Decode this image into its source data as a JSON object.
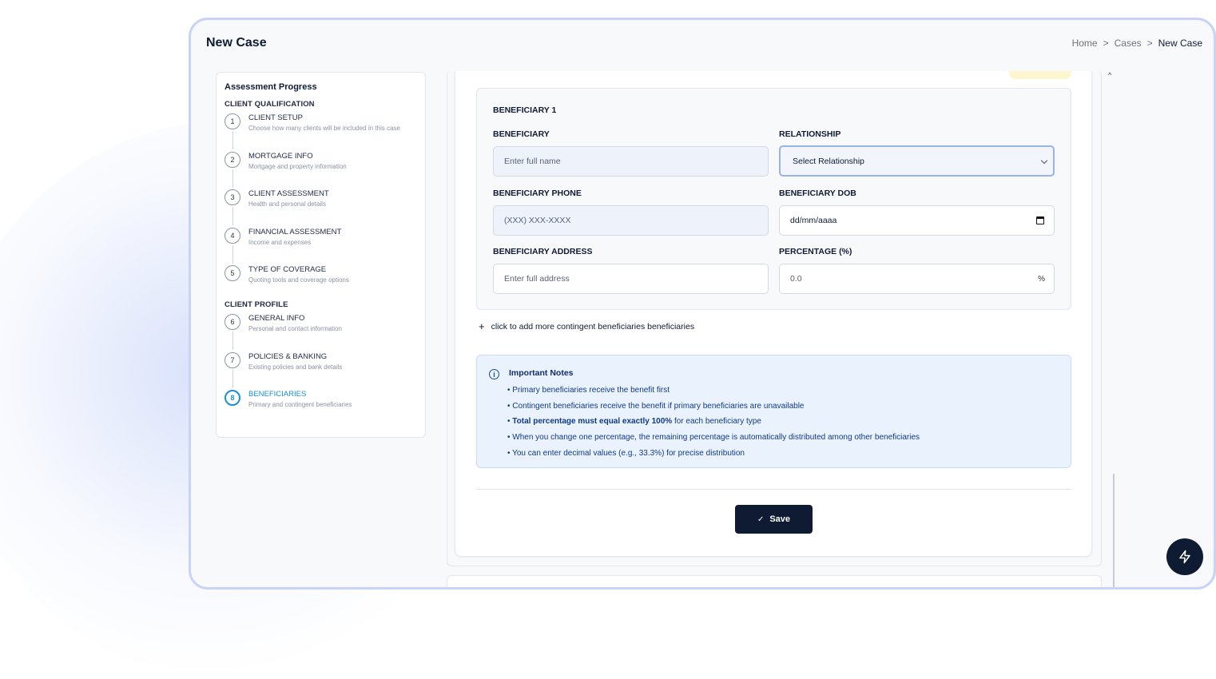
{
  "page": {
    "title": "New Case"
  },
  "breadcrumb": {
    "home": "Home",
    "cases": "Cases",
    "current": "New Case",
    "separator": ">"
  },
  "progress": {
    "title": "Assessment Progress",
    "groups": [
      {
        "title": "CLIENT QUALIFICATION"
      },
      {
        "title": "CLIENT PROFILE"
      }
    ],
    "steps": [
      {
        "num": "1",
        "title": "CLIENT SETUP",
        "desc": "Choose how many clients will be included in this case"
      },
      {
        "num": "2",
        "title": "MORTGAGE INFO",
        "desc": "Mortgage and property information"
      },
      {
        "num": "3",
        "title": "CLIENT ASSESSMENT",
        "desc": "Health and personal details"
      },
      {
        "num": "4",
        "title": "FINANCIAL ASSESSMENT",
        "desc": "Income and expenses"
      },
      {
        "num": "5",
        "title": "TYPE OF COVERAGE",
        "desc": "Quoting tools and coverage options"
      },
      {
        "num": "6",
        "title": "GENERAL INFO",
        "desc": "Personal and contact information"
      },
      {
        "num": "7",
        "title": "POLICIES & BANKING",
        "desc": "Existing policies and bank details"
      },
      {
        "num": "8",
        "title": "BENEFICIARIES",
        "desc": "Primary and contingent beneficiaries"
      }
    ]
  },
  "beneficiary": {
    "heading": "BENEFICIARY 1",
    "name_label": "BENEFICIARY",
    "name_placeholder": "Enter full name",
    "relationship_label": "RELATIONSHIP",
    "relationship_value": "Select Relationship",
    "phone_label": "BENEFICIARY PHONE",
    "phone_placeholder": "(XXX) XXX-XXXX",
    "dob_label": "BENEFICIARY DOB",
    "dob_placeholder": "dd/mm/aaaa",
    "address_label": "BENEFICIARY ADDRESS",
    "address_placeholder": "Enter full address",
    "percentage_label": "PERCENTAGE (%)",
    "percentage_value": "0.0",
    "percentage_suffix": "%"
  },
  "add_more": {
    "icon": "+",
    "label": "click to add more contingent beneficiaries beneficiaries"
  },
  "notes": {
    "icon": "i",
    "title": "Important Notes",
    "items": [
      "• Primary beneficiaries receive the benefit first",
      "• Contingent beneficiaries receive the benefit if primary beneficiaries are unavailable",
      "• When you change one percentage, the remaining percentage is automatically distributed among other beneficiaries",
      "• You can enter decimal values (e.g., 33.3%) for precise distribution"
    ],
    "bold_item_strong": "Total percentage must equal exactly 100%",
    "bold_item_rest": " for each beneficiary type",
    "bullet": "•"
  },
  "save": {
    "label": "Save",
    "icon": "✓"
  },
  "scroll_up_icon": "^"
}
